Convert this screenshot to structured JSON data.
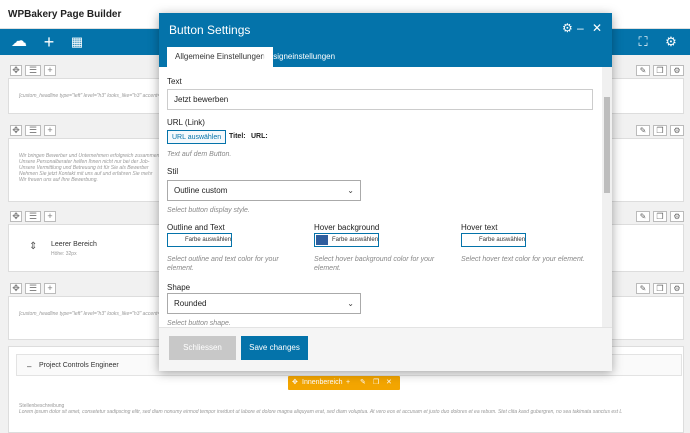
{
  "window": {
    "title": "WPBakery Page Builder"
  },
  "background": {
    "row1_text": "[custom_headline type=\"left\" level=\"h3\" looks_like=\"h3\" accent=\"",
    "row2_text_lines": [
      "Wir bringen Bewerber und Unternehmen erfolgreich zusammen",
      "Unsere Personalberater helfen Ihnen nicht nur bei der Job-",
      "Unsere Vermittlung und Betreuung ist für Sie als Bewerber ",
      "Nehmen Sie jetzt Kontakt mit uns auf und erfahren Sie mehr",
      "Wir freuen uns auf Ihre Bewerbung."
    ],
    "empty_title": "Leerer Bereich",
    "empty_sub": "Höhe: 32px",
    "row4_text": "[custom_headline type=\"left\" level=\"h3\" looks_like=\"h3\" accent=\"",
    "accordion_label": "Project Controls Engineer",
    "inner_label": "Innenbereich",
    "section_title": "Stellenbeschreibung",
    "section_text": "Lorem ipsum dolor sit amet, consetetur sadipscing elitr, sed diam nonumy eirmod tempor invidunt ut labore et dolore magna aliquyam erat, sed diam voluptua. At vero eos et accusam et justo duo dolores et ea rebum. Stet clita kasd gubergren, no sea takimata sanctus est L"
  },
  "modal": {
    "title": "Button Settings",
    "tabs": [
      "Allgemeine Einstellungen",
      "Designeinstellungen"
    ],
    "text_label": "Text",
    "text_value": "Jetzt bewerben",
    "url_label": "URL (Link)",
    "url_button": "URL auswählen",
    "url_title_label": "Titel:",
    "url_url_label": "URL:",
    "url_hint": "Text auf dem Button.",
    "style_label": "Stil",
    "style_value": "Outline custom",
    "style_hint": "Select button display style.",
    "outline_label": "Outline and Text",
    "outline_button": "Farbe auswählen",
    "outline_hint": "Select outline and text color for your element.",
    "hover_bg_label": "Hover background",
    "hover_bg_button": "Farbe auswählen",
    "hover_bg_hint": "Select hover background color for your element.",
    "hover_text_label": "Hover text",
    "hover_text_button": "Farbe auswählen",
    "hover_text_hint": "Select hover text color for your element.",
    "shape_label": "Shape",
    "shape_value": "Rounded",
    "shape_hint": "Select button shape.",
    "close_button": "Schliessen",
    "save_button": "Save changes"
  },
  "colors": {
    "accent": "#0473aa",
    "hover_bg_swatch": "#2f5e9e",
    "inner": "#f3a500"
  }
}
